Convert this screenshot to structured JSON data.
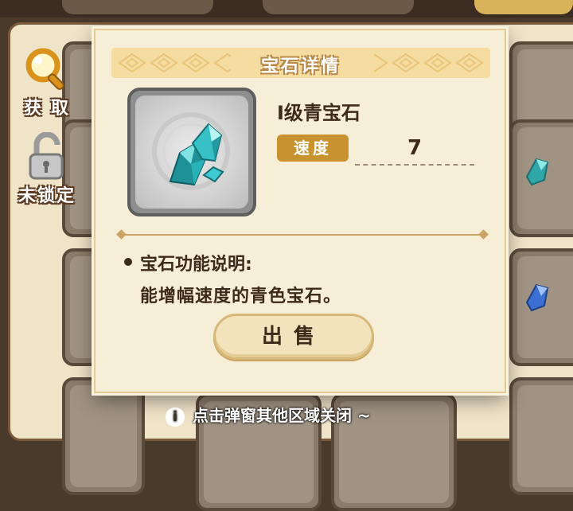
{
  "side_buttons": {
    "obtain": {
      "label": "获 取",
      "icon": "magnifier-icon"
    },
    "lock": {
      "label": "未锁定",
      "icon": "padlock-unlocked-icon"
    }
  },
  "dialog": {
    "title": "宝石详情",
    "gem": {
      "name": "I级青宝石",
      "icon": "cyan-gem-icon",
      "stat_label": "速度",
      "stat_value": "7"
    },
    "description": {
      "title": "宝石功能说明:",
      "text": "能增幅速度的青色宝石。"
    },
    "sell_button": "出售"
  },
  "footer_hint": "点击弹窗其他区域关闭 ~",
  "colors": {
    "accent": "#c8922f",
    "dialog_bg": "#f7eed7",
    "gem_cyan": "#3fc9d1"
  }
}
